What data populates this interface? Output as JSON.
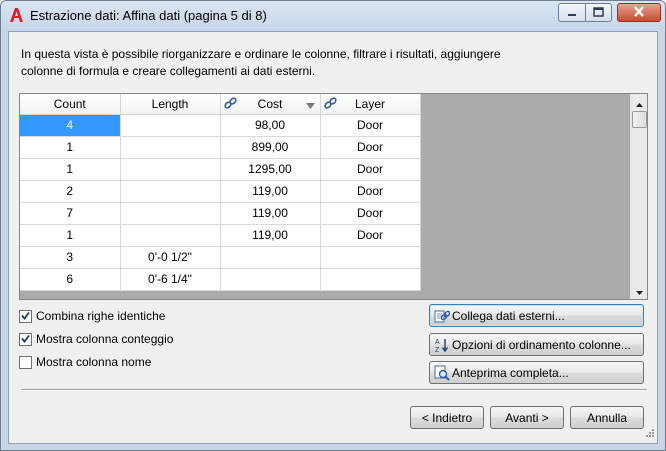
{
  "window": {
    "title": "Estrazione dati: Affina dati (pagina 5 di 8)",
    "icon": "autocad-a-icon"
  },
  "description": "In questa vista è possibile riorganizzare e ordinare le colonne, filtrare i risultati, aggiungere colonne di formula e creare collegamenti ai dati esterni.",
  "grid": {
    "columns": [
      {
        "label": "Count",
        "link_icon": false,
        "sort_arrow": false
      },
      {
        "label": "Length",
        "link_icon": false,
        "sort_arrow": false
      },
      {
        "label": "Cost",
        "link_icon": true,
        "sort_arrow": true
      },
      {
        "label": "Layer",
        "link_icon": true,
        "sort_arrow": false
      }
    ],
    "rows": [
      [
        "4",
        "",
        "98,00",
        "Door"
      ],
      [
        "1",
        "",
        "899,00",
        "Door"
      ],
      [
        "1",
        "",
        "1295,00",
        "Door"
      ],
      [
        "2",
        "",
        "119,00",
        "Door"
      ],
      [
        "7",
        "",
        "119,00",
        "Door"
      ],
      [
        "1",
        "",
        "119,00",
        "Door"
      ],
      [
        "3",
        "0'-0 1/2\"",
        "",
        ""
      ],
      [
        "6",
        "0'-6 1/4\"",
        "",
        ""
      ]
    ],
    "selected_cell": {
      "row": 0,
      "col": 0
    }
  },
  "options": {
    "combine": {
      "label": "Combina righe identiche",
      "checked": true
    },
    "count_column": {
      "label": "Mostra colonna conteggio",
      "checked": true
    },
    "name_column": {
      "label": "Mostra colonna nome",
      "checked": false
    }
  },
  "buttons": {
    "link_external": "Collega dati esterni...",
    "sort_options": "Opzioni di ordinamento colonne...",
    "full_preview": "Anteprima completa...",
    "back": "< Indietro",
    "next": "Avanti >",
    "cancel": "Annulla"
  },
  "colors": {
    "selection": "#3399ff",
    "dialog_bg": "#f0f0f0",
    "close_button": "#c74b31"
  }
}
